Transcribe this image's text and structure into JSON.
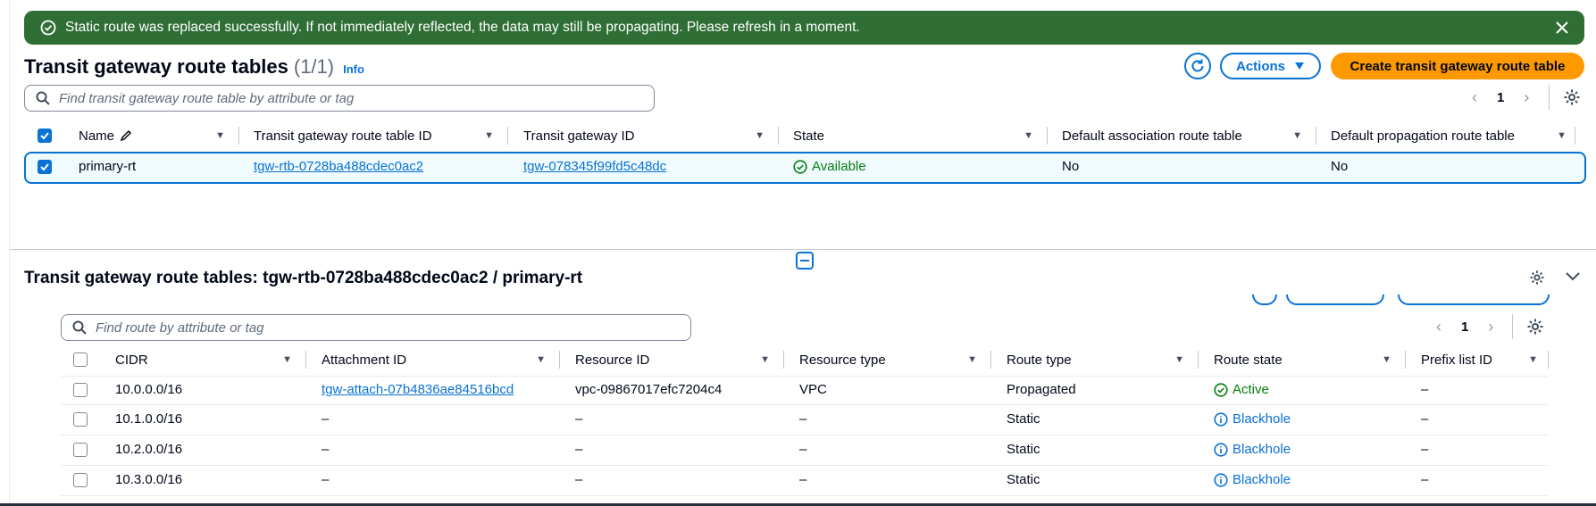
{
  "flash": {
    "message": "Static route was replaced successfully. If not immediately reflected, the data may still be propagating. Please refresh in a moment.",
    "color": "#2f6e35"
  },
  "top": {
    "title": "Transit gateway route tables",
    "count": "(1/1)",
    "info": "Info",
    "actions_label": "Actions",
    "create_label": "Create transit gateway route table",
    "search_placeholder": "Find transit gateway route table by attribute or tag",
    "page": "1",
    "columns": [
      "Name",
      "Transit gateway route table ID",
      "Transit gateway ID",
      "State",
      "Default association route table",
      "Default propagation route table"
    ],
    "row": {
      "name": "primary-rt",
      "route_table_id": "tgw-rtb-0728ba488cdec0ac2",
      "tgw_id": "tgw-078345f99fd5c48dc",
      "state": "Available",
      "default_assoc": "No",
      "default_prop": "No"
    }
  },
  "bottom": {
    "title": "Transit gateway route tables: tgw-rtb-0728ba488cdec0ac2 / primary-rt",
    "search_placeholder": "Find route by attribute or tag",
    "page": "1",
    "columns": [
      "CIDR",
      "Attachment ID",
      "Resource ID",
      "Resource type",
      "Route type",
      "Route state",
      "Prefix list ID"
    ],
    "rows": [
      {
        "cidr": "10.0.0.0/16",
        "attachment": "tgw-attach-07b4836ae84516bcd",
        "resource_id": "vpc-09867017efc7204c4",
        "resource_type": "VPC",
        "route_type": "Propagated",
        "state": "Active",
        "prefix": "–"
      },
      {
        "cidr": "10.1.0.0/16",
        "attachment": "–",
        "resource_id": "–",
        "resource_type": "–",
        "route_type": "Static",
        "state": "Blackhole",
        "prefix": "–"
      },
      {
        "cidr": "10.2.0.0/16",
        "attachment": "–",
        "resource_id": "–",
        "resource_type": "–",
        "route_type": "Static",
        "state": "Blackhole",
        "prefix": "–"
      },
      {
        "cidr": "10.3.0.0/16",
        "attachment": "–",
        "resource_id": "–",
        "resource_type": "–",
        "route_type": "Static",
        "state": "Blackhole",
        "prefix": "–"
      }
    ]
  }
}
